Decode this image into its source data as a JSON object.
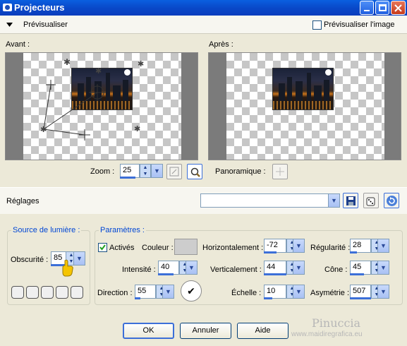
{
  "window": {
    "title": "Projecteurs"
  },
  "toolbar": {
    "preview_label": "Prévisualiser",
    "preview_image_label": "Prévisualiser l'image",
    "preview_image_checked": false
  },
  "panes": {
    "before_label": "Avant :",
    "after_label": "Après :"
  },
  "zoom": {
    "label": "Zoom :",
    "value": "25"
  },
  "pan": {
    "label": "Panoramique :"
  },
  "settings": {
    "label": "Réglages",
    "value": ""
  },
  "light_source": {
    "label": "Source de lumière :",
    "darkness_label": "Obscurité :",
    "darkness_value": "85"
  },
  "params": {
    "label": "Paramètres :",
    "active_label": "Activés",
    "active_checked": true,
    "color_label": "Couleur :",
    "color_value": "#cdcdcd",
    "intensity_label": "Intensité :",
    "intensity_value": "40",
    "direction_label": "Direction :",
    "direction_value": "55",
    "horizontal_label": "Horizontalement :",
    "horizontal_value": "-72",
    "vertical_label": "Verticalement :",
    "vertical_value": "44",
    "scale_label": "Échelle :",
    "scale_value": "10",
    "regularity_label": "Régularité :",
    "regularity_value": "28",
    "cone_label": "Cône :",
    "cone_value": "45",
    "asymmetry_label": "Asymétrie :",
    "asymmetry_value": "507"
  },
  "buttons": {
    "ok": "OK",
    "cancel": "Annuler",
    "help": "Aide"
  },
  "watermark": {
    "line1": "Pinuccia",
    "line2": "www.maidiregrafica.eu"
  },
  "colors": {
    "title_bar": "#0a4fd6",
    "accent_blue": "#3c6fd8",
    "group_label": "#0046d5"
  }
}
